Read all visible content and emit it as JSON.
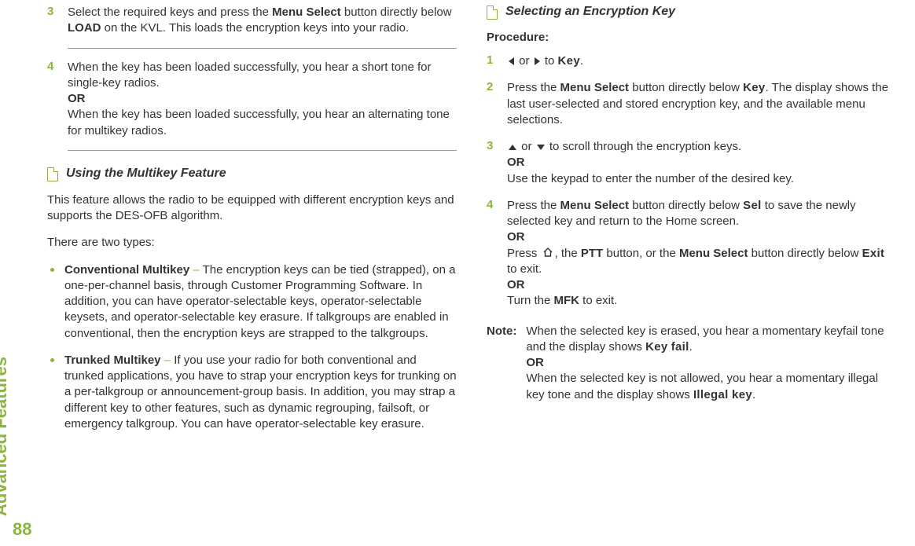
{
  "sidebar": {
    "label": "Advanced Features",
    "page_number": "88"
  },
  "left": {
    "step3": {
      "num": "3",
      "pre": "Select the required keys and press the ",
      "bold1": "Menu Select",
      "mid1": " button directly below ",
      "bold2": "LOAD",
      "tail": " on the KVL. This loads the encryption keys into your radio."
    },
    "step4": {
      "num": "4",
      "l1": "When the key has been loaded successfully, you hear a short tone for single-key radios.",
      "or": "OR",
      "l2": "When the key has been loaded successfully, you hear an alternating tone for multikey radios."
    },
    "section_title": "Using the Multikey Feature",
    "intro": "This feature allows the radio to be equipped with different encryption keys and supports the DES-OFB algorithm.",
    "types_label": "There are two types:",
    "bullet1": {
      "lead": "Conventional Multikey",
      "dash": " – ",
      "body": "The encryption keys can be tied (strapped), on a one-per-channel basis, through Customer Programming Software. In addition, you can have operator-selectable keys, operator-selectable keysets, and operator-selectable key erasure. If talkgroups are enabled in conventional, then the encryption keys are strapped to the talkgroups."
    },
    "bullet2": {
      "lead": "Trunked Multikey",
      "dash": " – ",
      "body": "If you use your radio for both conventional and trunked applications, you have to strap your encryption keys for trunking on a per-talkgroup or announcement-group basis. In addition, you may strap a different key to other features, such as dynamic regrouping, failsoft, or emergency talkgroup. You can have operator-selectable key erasure."
    }
  },
  "right": {
    "section_title": "Selecting an Encryption Key",
    "procedure_label": "Procedure:",
    "step1": {
      "num": "1",
      "or": " or ",
      "to": " to ",
      "key": "Key",
      "period": "."
    },
    "step2": {
      "num": "2",
      "pre": "Press the ",
      "bold1": "Menu Select",
      "mid1": " button directly below ",
      "key": "Key",
      "tail": ". The display shows the last user-selected and stored encryption key, and the available menu selections."
    },
    "step3": {
      "num": "3",
      "or_word": " or ",
      "l1_tail": " to scroll through the encryption keys.",
      "or": "OR",
      "l2": "Use the keypad to enter the number of the desired key."
    },
    "step4": {
      "num": "4",
      "pre": "Press the ",
      "bold1": "Menu Select",
      "mid1": " button directly below ",
      "sel": "Sel",
      "mid2": " to save the newly selected key and return to the Home screen.",
      "or1": "OR",
      "l2_pre": "Press ",
      "l2_mid1": ", the ",
      "ptt": "PTT",
      "l2_mid2": " button, or the ",
      "ms": "Menu Select",
      "l2_mid3": " button directly below ",
      "exit": "Exit",
      "l2_tail": " to exit.",
      "or2": "OR",
      "l3_pre": "Turn the ",
      "mfk": "MFK",
      "l3_tail": " to exit."
    },
    "note": {
      "label": "Note:",
      "l1_pre": "When the selected key is erased, you hear a momentary keyfail tone and the display shows ",
      "keyfail1": "Key",
      "keyfail2": "fail",
      "period1": ".",
      "or": "OR",
      "l2_pre": "When the selected key is not allowed, you hear a momentary illegal key tone and the display shows ",
      "illegal": "Illegal key",
      "period2": "."
    }
  }
}
